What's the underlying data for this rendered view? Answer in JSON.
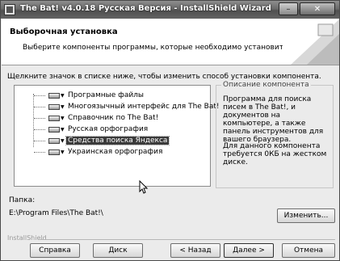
{
  "window": {
    "title": "The Bat! v4.0.18 Русская Версия - InstallShield Wizard",
    "minimize_glyph": "–",
    "close_glyph": "✕"
  },
  "header": {
    "title": "Выборочная установка",
    "subtitle": "Выберите компоненты программы, которые необходимо установить."
  },
  "instruction": "Щелкните значок в списке ниже, чтобы изменить способ установки компонента.",
  "tree": {
    "items": [
      {
        "label": "Програмные файлы",
        "selected": false
      },
      {
        "label": "Многоязычный интерфейс для The Bat!",
        "selected": false
      },
      {
        "label": "Справочник по The Bat!",
        "selected": false
      },
      {
        "label": "Русская орфография",
        "selected": false
      },
      {
        "label": "Средства поиска Яндекса",
        "selected": true
      },
      {
        "label": "Украинская орфография",
        "selected": false
      }
    ]
  },
  "description": {
    "legend": "Описание компонента",
    "text": "Программа для поиска писем в The Bat!, и документов на компьютере, а также панель инструментов для вашего браузера.",
    "space": "Для данного компонента требуется 0КБ на жестком диске."
  },
  "folder": {
    "label": "Папка:",
    "path": "E:\\Program Files\\The Bat!\\"
  },
  "buttons": {
    "change": "Изменить...",
    "help": "Справка",
    "disk": "Диск",
    "back": "< Назад",
    "next": "Далее >",
    "cancel": "Отмена"
  },
  "footer": {
    "brand": "InstallShield"
  },
  "colors": {
    "selection": "#3a3a3a",
    "dialog_bg": "#ebebeb"
  }
}
